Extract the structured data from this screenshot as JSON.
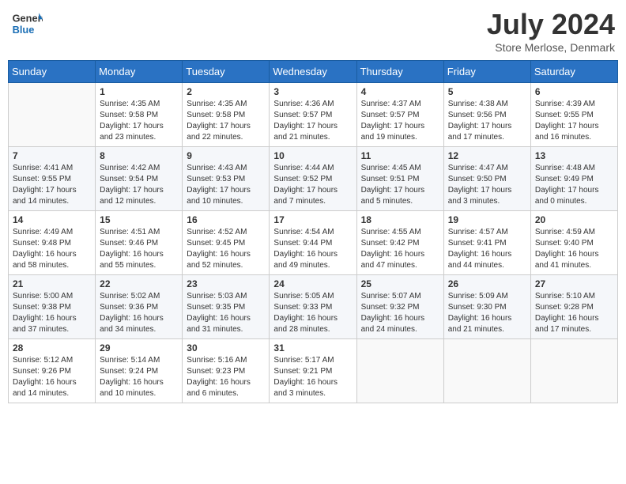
{
  "header": {
    "logo_general": "General",
    "logo_blue": "Blue",
    "month_year": "July 2024",
    "location": "Store Merlose, Denmark"
  },
  "weekdays": [
    "Sunday",
    "Monday",
    "Tuesday",
    "Wednesday",
    "Thursday",
    "Friday",
    "Saturday"
  ],
  "weeks": [
    [
      {
        "day": "",
        "sunrise": "",
        "sunset": "",
        "daylight": ""
      },
      {
        "day": "1",
        "sunrise": "Sunrise: 4:35 AM",
        "sunset": "Sunset: 9:58 PM",
        "daylight": "Daylight: 17 hours and 23 minutes."
      },
      {
        "day": "2",
        "sunrise": "Sunrise: 4:35 AM",
        "sunset": "Sunset: 9:58 PM",
        "daylight": "Daylight: 17 hours and 22 minutes."
      },
      {
        "day": "3",
        "sunrise": "Sunrise: 4:36 AM",
        "sunset": "Sunset: 9:57 PM",
        "daylight": "Daylight: 17 hours and 21 minutes."
      },
      {
        "day": "4",
        "sunrise": "Sunrise: 4:37 AM",
        "sunset": "Sunset: 9:57 PM",
        "daylight": "Daylight: 17 hours and 19 minutes."
      },
      {
        "day": "5",
        "sunrise": "Sunrise: 4:38 AM",
        "sunset": "Sunset: 9:56 PM",
        "daylight": "Daylight: 17 hours and 17 minutes."
      },
      {
        "day": "6",
        "sunrise": "Sunrise: 4:39 AM",
        "sunset": "Sunset: 9:55 PM",
        "daylight": "Daylight: 17 hours and 16 minutes."
      }
    ],
    [
      {
        "day": "7",
        "sunrise": "Sunrise: 4:41 AM",
        "sunset": "Sunset: 9:55 PM",
        "daylight": "Daylight: 17 hours and 14 minutes."
      },
      {
        "day": "8",
        "sunrise": "Sunrise: 4:42 AM",
        "sunset": "Sunset: 9:54 PM",
        "daylight": "Daylight: 17 hours and 12 minutes."
      },
      {
        "day": "9",
        "sunrise": "Sunrise: 4:43 AM",
        "sunset": "Sunset: 9:53 PM",
        "daylight": "Daylight: 17 hours and 10 minutes."
      },
      {
        "day": "10",
        "sunrise": "Sunrise: 4:44 AM",
        "sunset": "Sunset: 9:52 PM",
        "daylight": "Daylight: 17 hours and 7 minutes."
      },
      {
        "day": "11",
        "sunrise": "Sunrise: 4:45 AM",
        "sunset": "Sunset: 9:51 PM",
        "daylight": "Daylight: 17 hours and 5 minutes."
      },
      {
        "day": "12",
        "sunrise": "Sunrise: 4:47 AM",
        "sunset": "Sunset: 9:50 PM",
        "daylight": "Daylight: 17 hours and 3 minutes."
      },
      {
        "day": "13",
        "sunrise": "Sunrise: 4:48 AM",
        "sunset": "Sunset: 9:49 PM",
        "daylight": "Daylight: 17 hours and 0 minutes."
      }
    ],
    [
      {
        "day": "14",
        "sunrise": "Sunrise: 4:49 AM",
        "sunset": "Sunset: 9:48 PM",
        "daylight": "Daylight: 16 hours and 58 minutes."
      },
      {
        "day": "15",
        "sunrise": "Sunrise: 4:51 AM",
        "sunset": "Sunset: 9:46 PM",
        "daylight": "Daylight: 16 hours and 55 minutes."
      },
      {
        "day": "16",
        "sunrise": "Sunrise: 4:52 AM",
        "sunset": "Sunset: 9:45 PM",
        "daylight": "Daylight: 16 hours and 52 minutes."
      },
      {
        "day": "17",
        "sunrise": "Sunrise: 4:54 AM",
        "sunset": "Sunset: 9:44 PM",
        "daylight": "Daylight: 16 hours and 49 minutes."
      },
      {
        "day": "18",
        "sunrise": "Sunrise: 4:55 AM",
        "sunset": "Sunset: 9:42 PM",
        "daylight": "Daylight: 16 hours and 47 minutes."
      },
      {
        "day": "19",
        "sunrise": "Sunrise: 4:57 AM",
        "sunset": "Sunset: 9:41 PM",
        "daylight": "Daylight: 16 hours and 44 minutes."
      },
      {
        "day": "20",
        "sunrise": "Sunrise: 4:59 AM",
        "sunset": "Sunset: 9:40 PM",
        "daylight": "Daylight: 16 hours and 41 minutes."
      }
    ],
    [
      {
        "day": "21",
        "sunrise": "Sunrise: 5:00 AM",
        "sunset": "Sunset: 9:38 PM",
        "daylight": "Daylight: 16 hours and 37 minutes."
      },
      {
        "day": "22",
        "sunrise": "Sunrise: 5:02 AM",
        "sunset": "Sunset: 9:36 PM",
        "daylight": "Daylight: 16 hours and 34 minutes."
      },
      {
        "day": "23",
        "sunrise": "Sunrise: 5:03 AM",
        "sunset": "Sunset: 9:35 PM",
        "daylight": "Daylight: 16 hours and 31 minutes."
      },
      {
        "day": "24",
        "sunrise": "Sunrise: 5:05 AM",
        "sunset": "Sunset: 9:33 PM",
        "daylight": "Daylight: 16 hours and 28 minutes."
      },
      {
        "day": "25",
        "sunrise": "Sunrise: 5:07 AM",
        "sunset": "Sunset: 9:32 PM",
        "daylight": "Daylight: 16 hours and 24 minutes."
      },
      {
        "day": "26",
        "sunrise": "Sunrise: 5:09 AM",
        "sunset": "Sunset: 9:30 PM",
        "daylight": "Daylight: 16 hours and 21 minutes."
      },
      {
        "day": "27",
        "sunrise": "Sunrise: 5:10 AM",
        "sunset": "Sunset: 9:28 PM",
        "daylight": "Daylight: 16 hours and 17 minutes."
      }
    ],
    [
      {
        "day": "28",
        "sunrise": "Sunrise: 5:12 AM",
        "sunset": "Sunset: 9:26 PM",
        "daylight": "Daylight: 16 hours and 14 minutes."
      },
      {
        "day": "29",
        "sunrise": "Sunrise: 5:14 AM",
        "sunset": "Sunset: 9:24 PM",
        "daylight": "Daylight: 16 hours and 10 minutes."
      },
      {
        "day": "30",
        "sunrise": "Sunrise: 5:16 AM",
        "sunset": "Sunset: 9:23 PM",
        "daylight": "Daylight: 16 hours and 6 minutes."
      },
      {
        "day": "31",
        "sunrise": "Sunrise: 5:17 AM",
        "sunset": "Sunset: 9:21 PM",
        "daylight": "Daylight: 16 hours and 3 minutes."
      },
      {
        "day": "",
        "sunrise": "",
        "sunset": "",
        "daylight": ""
      },
      {
        "day": "",
        "sunrise": "",
        "sunset": "",
        "daylight": ""
      },
      {
        "day": "",
        "sunrise": "",
        "sunset": "",
        "daylight": ""
      }
    ]
  ]
}
